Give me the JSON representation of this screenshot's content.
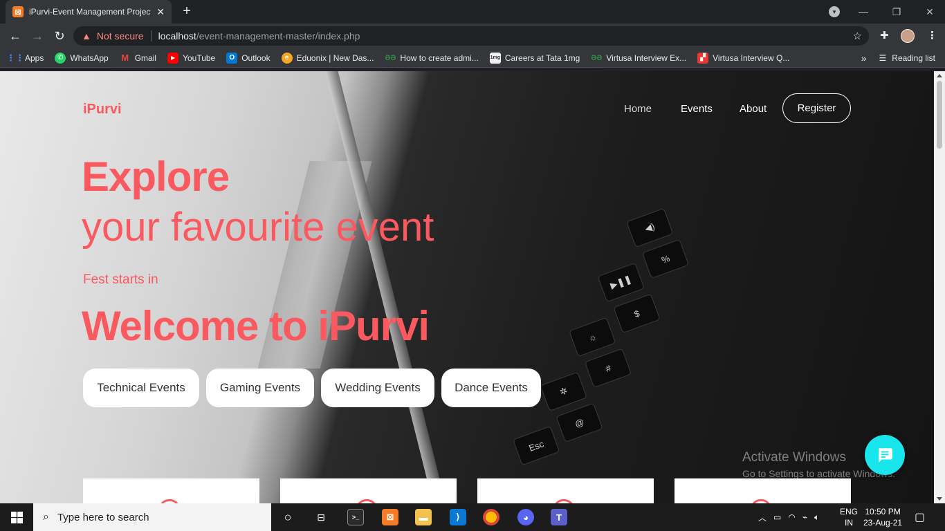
{
  "browser": {
    "tab_title": "iPurvi-Event Management Project",
    "tab_close": "✕",
    "new_tab": "+",
    "security_label": "Not secure",
    "url_host": "localhost",
    "url_path": "/event-management-master/index.php",
    "bookmarks": [
      {
        "label": "Apps",
        "icon": "apps-grid-icon",
        "color": "#4285f4"
      },
      {
        "label": "WhatsApp",
        "icon": "whatsapp-icon",
        "color": "#25d366"
      },
      {
        "label": "Gmail",
        "icon": "gmail-icon",
        "color": "#ea4335"
      },
      {
        "label": "YouTube",
        "icon": "youtube-icon",
        "color": "#ff0000"
      },
      {
        "label": "Outlook",
        "icon": "outlook-icon",
        "color": "#0078d4"
      },
      {
        "label": "Eduonix | New Das...",
        "icon": "eduonix-icon",
        "color": "#f5a623"
      },
      {
        "label": "How to create admi...",
        "icon": "geeksforgeeks-icon",
        "color": "#2f8d46"
      },
      {
        "label": "Careers at Tata 1mg",
        "icon": "tata-1mg-icon",
        "color": "#ff6f61"
      },
      {
        "label": "Virtusa Interview Ex...",
        "icon": "geeksforgeeks-icon",
        "color": "#2f8d46"
      },
      {
        "label": "Virtusa Interview Q...",
        "icon": "virtusa-icon",
        "color": "#e53935"
      }
    ],
    "more_bookmarks": "»",
    "reading_list": "Reading list"
  },
  "site": {
    "logo": "iPurvi",
    "nav": {
      "home": "Home",
      "events": "Events",
      "about": "About",
      "register": "Register"
    },
    "hero": {
      "line1": "Explore",
      "line2": "your favourite event",
      "fest_label": "Fest starts in",
      "welcome": "Welcome to iPurvi"
    },
    "categories": [
      "Technical Events",
      "Gaming Events",
      "Wedding Events",
      "Dance Events"
    ],
    "accent_color": "#f9595f",
    "chat_color": "#18e6ec"
  },
  "windows_watermark": {
    "title": "Activate Windows",
    "subtitle": "Go to Settings to activate Windows."
  },
  "taskbar": {
    "search_placeholder": "Type here to search",
    "language_line1": "ENG",
    "language_line2": "IN",
    "time": "10:50 PM",
    "date": "23-Aug-21"
  }
}
